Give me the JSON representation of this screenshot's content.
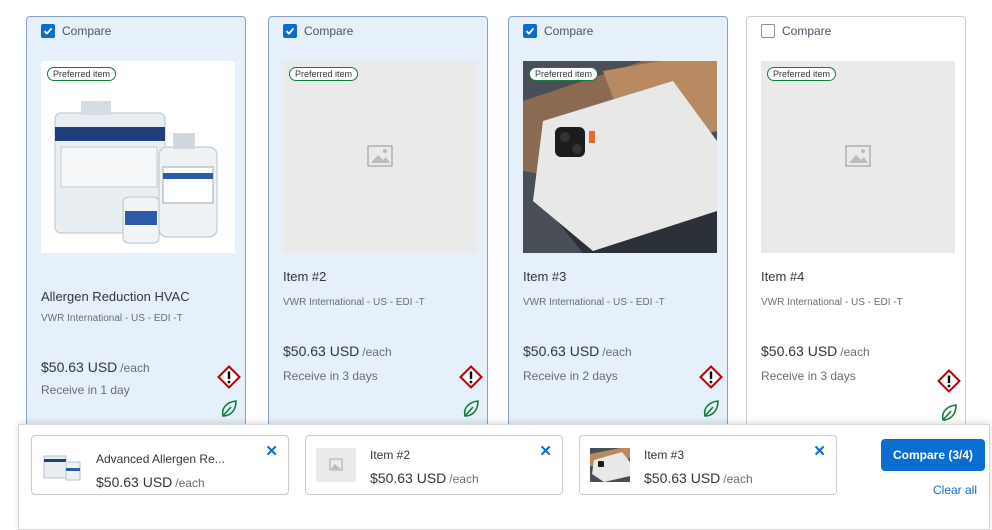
{
  "compare_label": "Compare",
  "preferred_label": "Preferred item",
  "cards": [
    {
      "checked": true,
      "title": "Allergen Reduction HVAC",
      "supplier": "VWR International - US - EDI -T",
      "price": "$50.63 USD",
      "unit": "/each",
      "delivery": "Receive in 1 day"
    },
    {
      "checked": true,
      "title": "Item #2",
      "supplier": "VWR International - US - EDI -T",
      "price": "$50.63 USD",
      "unit": "/each",
      "delivery": "Receive in 3 days"
    },
    {
      "checked": true,
      "title": "Item #3",
      "supplier": "VWR International - US - EDI -T",
      "price": "$50.63 USD",
      "unit": "/each",
      "delivery": "Receive in 2 days"
    },
    {
      "checked": false,
      "title": "Item #4",
      "supplier": "VWR International - US - EDI -T",
      "price": "$50.63 USD",
      "unit": "/each",
      "delivery": "Receive in 3 days"
    }
  ],
  "tray": {
    "items": [
      {
        "name": "Advanced Allergen Re...",
        "price": "$50.63 USD",
        "unit": "/each"
      },
      {
        "name": "Item #2",
        "price": "$50.63 USD",
        "unit": "/each"
      },
      {
        "name": "Item #3",
        "price": "$50.63 USD",
        "unit": "/each"
      }
    ],
    "compare_button": "Compare (3/4)",
    "clear_all": "Clear all"
  },
  "colors": {
    "accent": "#0a6ed1",
    "hazard": "#bb0000",
    "eco": "#107e3e",
    "selected_card_bg": "#e6f0fa"
  }
}
